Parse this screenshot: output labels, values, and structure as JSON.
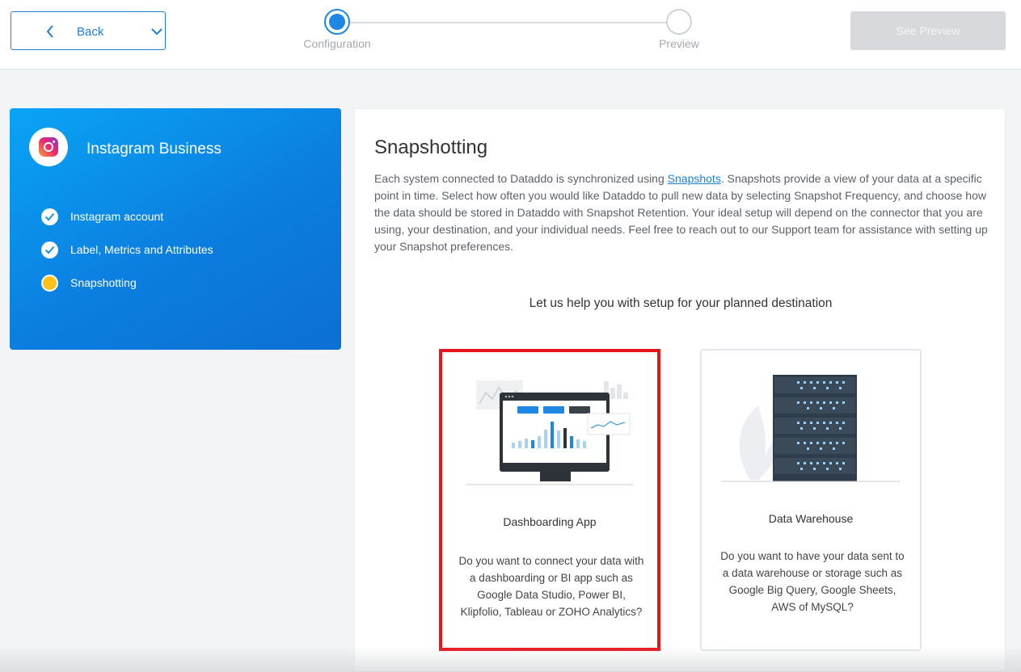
{
  "header": {
    "back_label": "Back",
    "steps": [
      {
        "label": "Configuration",
        "state": "active"
      },
      {
        "label": "Preview",
        "state": "pending"
      }
    ],
    "see_preview_label": "See Preview"
  },
  "connector": {
    "name": "Instagram Business",
    "icon": "instagram-icon",
    "steps": [
      {
        "label": "Instagram account",
        "status": "done"
      },
      {
        "label": "Label, Metrics and Attributes",
        "status": "done"
      },
      {
        "label": "Snapshotting",
        "status": "current"
      }
    ]
  },
  "main": {
    "title": "Snapshotting",
    "desc_before_link": "Each system connected to Dataddo is synchronized using ",
    "desc_link": "Snapshots",
    "desc_after_link": ". Snapshots provide a view of your data at a specific point in time. Select how often you would like Dataddo to pull new data by selecting Snapshot Frequency, and choose how the data should be stored in Dataddo with Snapshot Retention. Your ideal setup will depend on the connector that you are using, your destination, and your individual needs. Feel free to reach out to our Support team for assistance with setting up your Snapshot preferences.",
    "help_title": "Let us help you with setup for your planned destination",
    "options": [
      {
        "title": "Dashboarding App",
        "description": "Do you want to connect your data with a dashboarding or BI app such as Google Data Studio, Power BI, Klipfolio, Tableau or ZOHO Analytics?",
        "selected": true
      },
      {
        "title": "Data Warehouse",
        "description": "Do you want to have your data sent to a data warehouse or storage such as Google Big Query, Google Sheets, AWS of MySQL?",
        "selected": false
      }
    ]
  },
  "colors": {
    "accent": "#1e7fd8",
    "selected_border": "#e8141b",
    "pending_step": "#ffc21a"
  }
}
